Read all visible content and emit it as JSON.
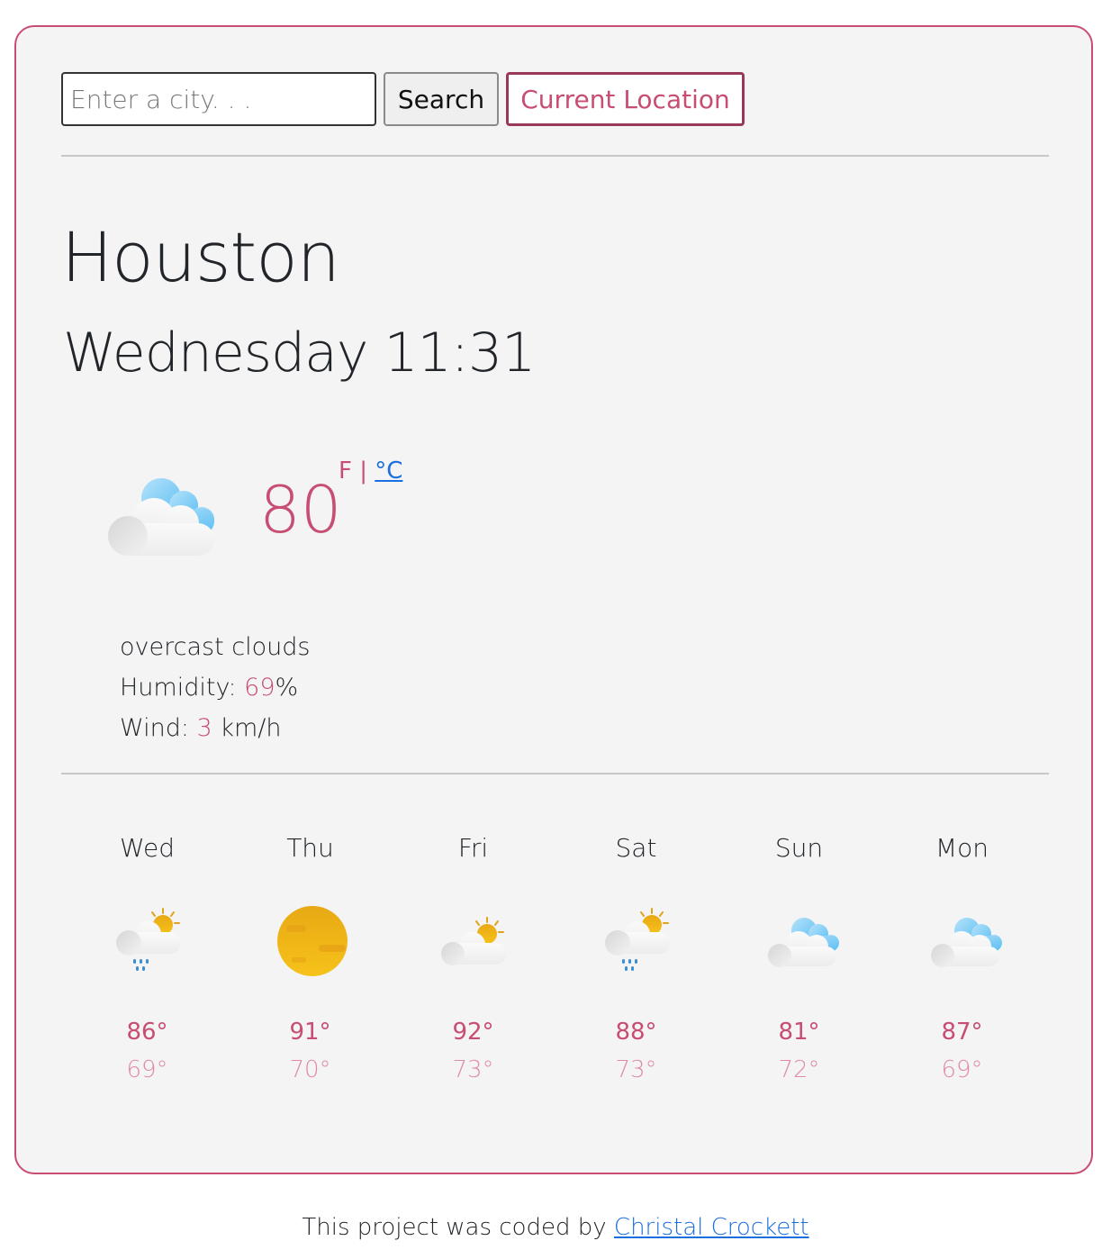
{
  "search": {
    "placeholder": "Enter a city. . .",
    "value": "",
    "search_label": "Search",
    "location_label": "Current Location"
  },
  "current": {
    "city": "Houston",
    "datetime": "Wednesday 11:31",
    "icon": "overcast-clouds-icon",
    "temperature": "80",
    "unit_f": "F",
    "unit_sep": "|",
    "unit_c": "°C",
    "description": "overcast clouds",
    "humidity_label": "Humidity:",
    "humidity_value": "69",
    "humidity_unit": "%",
    "wind_label": "Wind:",
    "wind_value": "3",
    "wind_unit": "km/h"
  },
  "forecast": [
    {
      "day": "Wed",
      "icon": "rain-sun-icon",
      "high": "86°",
      "low": "69°"
    },
    {
      "day": "Thu",
      "icon": "sun-icon",
      "high": "91°",
      "low": "70°"
    },
    {
      "day": "Fri",
      "icon": "partly-cloudy-icon",
      "high": "92°",
      "low": "73°"
    },
    {
      "day": "Sat",
      "icon": "rain-sun-icon",
      "high": "88°",
      "low": "73°"
    },
    {
      "day": "Sun",
      "icon": "cloudy-icon",
      "high": "81°",
      "low": "72°"
    },
    {
      "day": "Mon",
      "icon": "cloudy-icon",
      "high": "87°",
      "low": "69°"
    }
  ],
  "footer": {
    "text": "This project was coded by",
    "author": "Christal Crockett"
  },
  "colors": {
    "accent": "#c84d72",
    "accent_light": "#e08ba6",
    "link": "#1a6fe0",
    "card_bg": "#f4f4f4"
  }
}
